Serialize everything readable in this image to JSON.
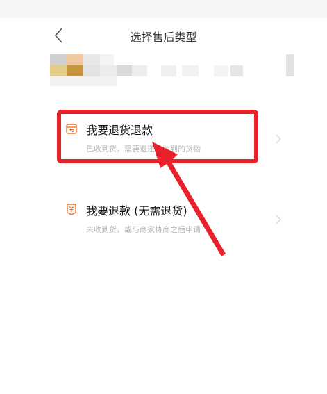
{
  "header": {
    "title": "选择售后类型"
  },
  "icons": {
    "back": "chevron-left-icon",
    "return_refund": "return-box-icon",
    "refund_only": "yen-icon",
    "chevron": "chevron-right-icon"
  },
  "colors": {
    "accent": "#f07030",
    "highlight": "#e8212b",
    "desc": "#b5b5b5"
  },
  "options": [
    {
      "title": "我要退货退款",
      "description": "已收到货，需要退还已收到的货物"
    },
    {
      "title": "我要退款 (无需退货)",
      "description": "未收到货，或与商家协商之后申请"
    }
  ]
}
